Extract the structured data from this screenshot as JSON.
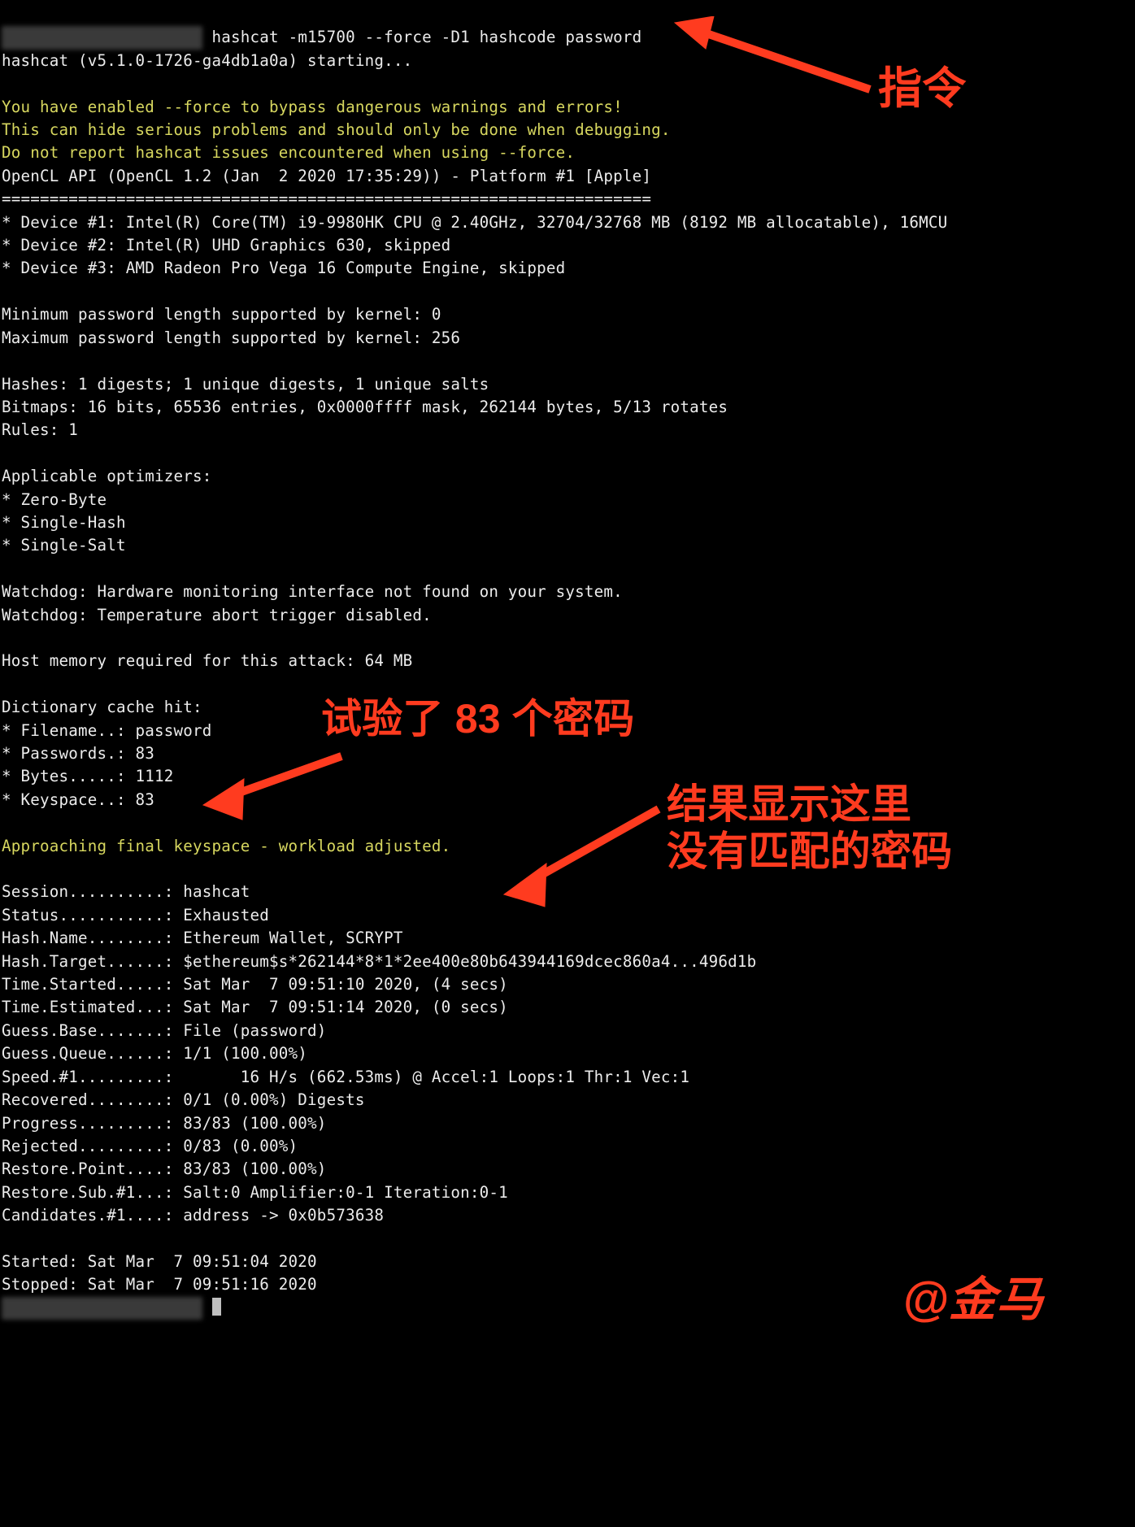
{
  "command_prefix": "  ■ ■   ■■ ■   ■■■■  ",
  "command": " hashcat -m15700 --force -D1 hashcode password",
  "starting": "hashcat (v5.1.0-1726-ga4db1a0a) starting...",
  "warn1": "You have enabled --force to bypass dangerous warnings and errors!",
  "warn2": "This can hide serious problems and should only be done when debugging.",
  "warn3": "Do not report hashcat issues encountered when using --force.",
  "opencl": "OpenCL API (OpenCL 1.2 (Jan  2 2020 17:35:29)) - Platform #1 [Apple]",
  "sep": "====================================================================",
  "dev1": "* Device #1: Intel(R) Core(TM) i9-9980HK CPU @ 2.40GHz, 32704/32768 MB (8192 MB allocatable), 16MCU",
  "dev2": "* Device #2: Intel(R) UHD Graphics 630, skipped",
  "dev3": "* Device #3: AMD Radeon Pro Vega 16 Compute Engine, skipped",
  "minlen": "Minimum password length supported by kernel: 0",
  "maxlen": "Maximum password length supported by kernel: 256",
  "hashes": "Hashes: 1 digests; 1 unique digests, 1 unique salts",
  "bitmaps": "Bitmaps: 16 bits, 65536 entries, 0x0000ffff mask, 262144 bytes, 5/13 rotates",
  "rules": "Rules: 1",
  "appopt": "Applicable optimizers:",
  "opt1": "* Zero-Byte",
  "opt2": "* Single-Hash",
  "opt3": "* Single-Salt",
  "watch1": "Watchdog: Hardware monitoring interface not found on your system.",
  "watch2": "Watchdog: Temperature abort trigger disabled.",
  "hostmem": "Host memory required for this attack: 64 MB",
  "dict": "Dictionary cache hit:",
  "d_file": "* Filename..: password",
  "d_pw": "* Passwords.: 83",
  "d_bytes": "* Bytes.....: 1112",
  "d_keys": "* Keyspace..: 83",
  "approach": "Approaching final keyspace - workload adjusted.",
  "s_session": "Session..........: hashcat",
  "s_status": "Status...........: Exhausted",
  "s_hashname": "Hash.Name........: Ethereum Wallet, SCRYPT",
  "s_hashtarget": "Hash.Target......: $ethereum$s*262144*8*1*2ee400e80b643944169dcec860a4...496d1b",
  "s_timestart": "Time.Started.....: Sat Mar  7 09:51:10 2020, (4 secs)",
  "s_timeest": "Time.Estimated...: Sat Mar  7 09:51:14 2020, (0 secs)",
  "s_guessbase": "Guess.Base.......: File (password)",
  "s_guessq": "Guess.Queue......: 1/1 (100.00%)",
  "s_speed": "Speed.#1.........:       16 H/s (662.53ms) @ Accel:1 Loops:1 Thr:1 Vec:1",
  "s_recovered": "Recovered........: 0/1 (0.00%) Digests",
  "s_progress": "Progress.........: 83/83 (100.00%)",
  "s_rejected": "Rejected.........: 0/83 (0.00%)",
  "s_rpoint": "Restore.Point....: 83/83 (100.00%)",
  "s_rsub": "Restore.Sub.#1...: Salt:0 Amplifier:0-1 Iteration:0-1",
  "s_cand": "Candidates.#1....: address -> 0x0b573638",
  "started": "Started: Sat Mar  7 09:51:04 2020",
  "stopped": "Stopped: Sat Mar  7 09:51:16 2020",
  "anno_cmd": "指令",
  "anno_tried": "试验了 83 个密码",
  "anno_result1": "结果显示这里",
  "anno_result2": "没有匹配的密码",
  "anno_sign": "@金马"
}
